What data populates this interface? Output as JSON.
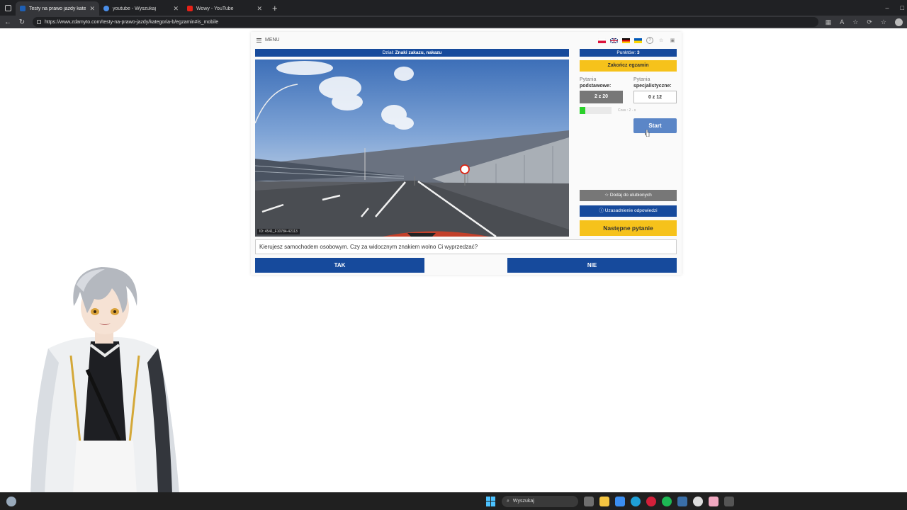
{
  "browser": {
    "tabs": [
      {
        "title": "Testy na prawo jazdy kategoria B",
        "active": true,
        "favicon_color": "#1e5fb4"
      },
      {
        "title": "youtube - Wyszukaj",
        "active": false,
        "favicon_color": "#4a8ee8"
      },
      {
        "title": "Wowy - YouTube",
        "active": false,
        "favicon_color": "#e62117"
      }
    ],
    "new_tab": "+",
    "url": "https://www.zdamyto.com/testy-na-prawo-jazdy/kategoria-b/egzamin#is_mobile",
    "window_controls": [
      "–",
      "□"
    ]
  },
  "page": {
    "menu_label": "MENU",
    "flags": [
      "pl",
      "gb",
      "de",
      "ua"
    ],
    "top_icons": [
      "help-icon",
      "star-icon",
      "calendar-icon"
    ],
    "section_prefix": "Dział:",
    "section_name": "Znaki zakazu, nakazu",
    "video_id": "ID: 4541_F10784-42113",
    "points_label": "Punktów:",
    "points_value": "3",
    "finish_exam": "Zakończ egzamin",
    "basic_label_1": "Pytania",
    "basic_label_2": "podstawowe:",
    "basic_counter": "2 z 20",
    "special_label_1": "Pytania",
    "special_label_2": "specjalistyczne:",
    "special_counter": "0 z 12",
    "timer_progress": 0.18,
    "time_text": "Czas : 2 - s",
    "start_button": "Start",
    "add_favorite": "Dodaj do ulubionych",
    "explanation": "Uzasadnienie odpowiedzi",
    "next_question": "Następne pytanie",
    "question": "Kierujesz samochodem osobowym. Czy za widocznym znakiem wolno Ci wyprzedzać?",
    "answer_yes": "TAK",
    "answer_no": "NIE"
  },
  "taskbar": {
    "search_placeholder": "Wyszukaj",
    "apps": [
      {
        "name": "task-view-icon",
        "color": "#6f6f6f"
      },
      {
        "name": "file-explorer-icon",
        "color": "#f4c542"
      },
      {
        "name": "store-icon",
        "color": "#3b8ef0"
      },
      {
        "name": "edge-icon",
        "color": "#1fa0d8"
      },
      {
        "name": "opera-icon",
        "color": "#d3203a"
      },
      {
        "name": "spotify-icon",
        "color": "#1db954"
      },
      {
        "name": "steam-icon",
        "color": "#3a6fa8"
      },
      {
        "name": "chrome-icon",
        "color": "#dddddd"
      },
      {
        "name": "app-pink-icon",
        "color": "#f0a8c0"
      },
      {
        "name": "app-dark-icon",
        "color": "#555555"
      }
    ]
  }
}
